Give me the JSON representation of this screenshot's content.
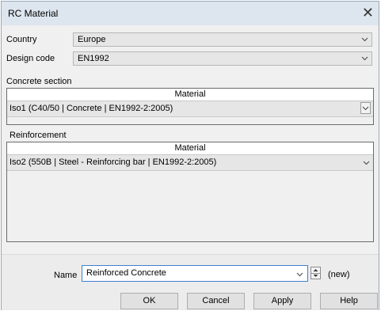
{
  "window": {
    "title": "RC Material"
  },
  "fields": {
    "country_label": "Country",
    "country_value": "Europe",
    "design_code_label": "Design code",
    "design_code_value": "EN1992"
  },
  "concrete_section": {
    "label": "Concrete section",
    "column_header": "Material",
    "row_value": "Iso1 (C40/50 | Concrete | EN1992-2:2005)"
  },
  "reinforcement": {
    "label": "Reinforcement",
    "column_header": "Material",
    "row_value": "Iso2 (550B | Steel - Reinforcing bar | EN1992-2:2005)"
  },
  "name": {
    "label": "Name",
    "value": "Reinforced Concrete",
    "status": "(new)"
  },
  "buttons": {
    "ok": "OK",
    "cancel": "Cancel",
    "apply": "Apply",
    "help": "Help"
  },
  "icons": {
    "close": "close-icon",
    "dropdown": "chevron-down-icon",
    "spin_up": "spin-up-icon",
    "spin_down": "spin-down-icon"
  }
}
